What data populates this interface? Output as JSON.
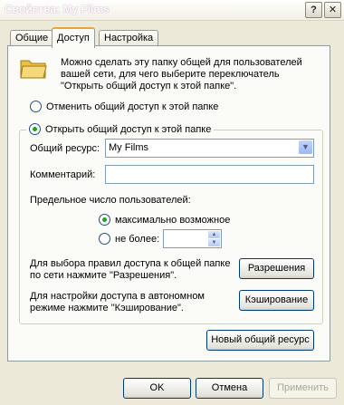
{
  "window": {
    "title": "Свойства: My Films",
    "help_btn": "?",
    "close_btn": "✕"
  },
  "tabs": [
    {
      "label": "Общие"
    },
    {
      "label": "Доступ"
    },
    {
      "label": "Настройка"
    }
  ],
  "sharing": {
    "info": "Можно сделать эту папку общей для пользователей вашей сети, для чего выберите переключатель \"Открыть общий доступ к этой папке\".",
    "radio_unshare": "Отменить общий доступ к этой папке",
    "radio_share": "Открыть общий доступ к этой папке",
    "share_name_label": "Общий ресурс:",
    "share_name_value": "My Films",
    "comment_label": "Комментарий:",
    "comment_value": "",
    "user_limit_label": "Предельное число пользователей:",
    "radio_max": "максимально возможное",
    "radio_limit": "не более:",
    "limit_value": "",
    "permissions_text": "Для выбора правил доступа к общей папке по сети нажмите \"Разрешения\".",
    "permissions_btn": "Разрешения",
    "caching_text": "Для настройки доступа в автономном режиме нажмите \"Кэширование\".",
    "caching_btn": "Кэширование",
    "new_share_btn": "Новый общий ресурс"
  },
  "footer": {
    "ok": "OK",
    "cancel": "Отмена",
    "apply": "Применить"
  }
}
